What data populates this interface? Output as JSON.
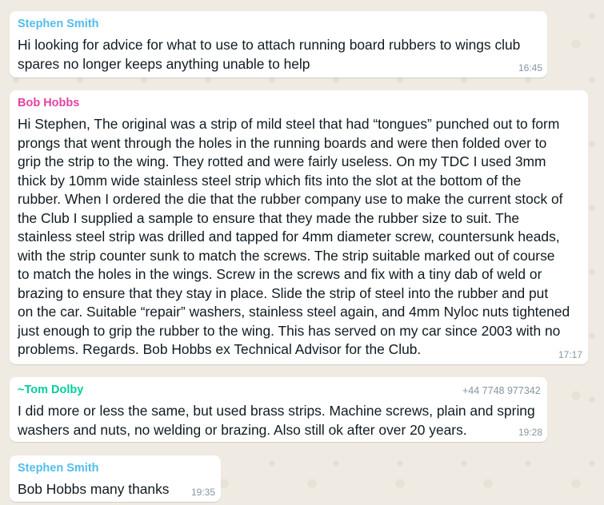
{
  "colors": {
    "chat_background": "#efeae2",
    "bubble": "#ffffff",
    "stephen_smith": "#53bdeb",
    "bob_hobbs": "#e542a3",
    "tom_dolby": "#06cf9c",
    "meta_text": "#8696a0"
  },
  "messages": [
    {
      "sender": "Stephen Smith",
      "text": "Hi looking for advice for what to use to attach running board rubbers to wings club\nspares no longer keeps anything unable to help",
      "time": "16:45"
    },
    {
      "sender": "Bob Hobbs",
      "text": "Hi Stephen, The original was a strip of mild steel that had “tongues” punched out to form\nprongs that went through the holes in the running boards and were then folded over to\ngrip the strip to the wing. They rotted and were fairly useless. On my TDC I used 3mm\nthick by 10mm wide stainless steel strip which fits into the slot at the bottom of the\nrubber. When I ordered the die that the rubber company use to make the current stock of\nthe Club I supplied a sample to ensure that they made the rubber size to suit. The\nstainless steel strip was drilled and tapped for 4mm diameter screw, countersunk heads,\nwith the strip counter sunk to match the screws. The strip suitable marked out of course\nto match the holes in the wings. Screw in the screws and fix with a tiny dab of weld or\nbrazing to ensure that they stay in place. Slide the strip of steel into the rubber and put\non the car. Suitable “repair” washers, stainless steel again, and 4mm Nyloc nuts tightened\njust enough to grip the rubber to the wing. This has served on my car since 2003 with no\nproblems. Regards. Bob Hobbs ex Technical Advisor for the Club.",
      "time": "17:17"
    },
    {
      "sender": "~Tom Dolby",
      "phone": "+44 7748 977342",
      "text": "I did more or less the same, but used brass strips. Machine screws, plain and spring\nwashers and nuts, no welding or brazing. Also still ok after over 20 years.",
      "time": "19:28"
    },
    {
      "sender": "Stephen Smith",
      "text": "Bob Hobbs many thanks",
      "time": "19:35"
    }
  ]
}
